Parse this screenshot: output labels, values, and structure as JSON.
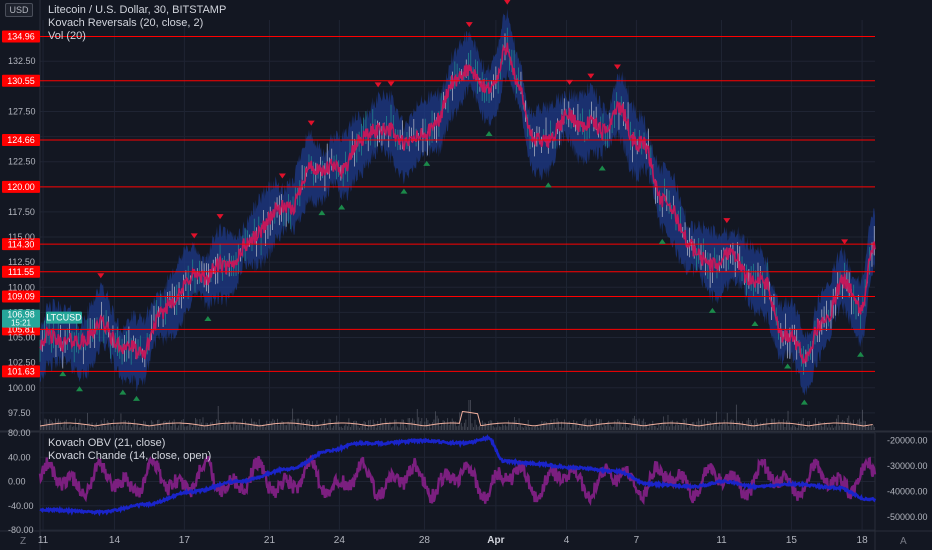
{
  "header": {
    "currency_badge": "USD",
    "title": "Litecoin / U.S. Dollar, 30, BITSTAMP",
    "indicators": [
      "Kovach Reversals (20, close, 2)",
      "Vol (20)"
    ]
  },
  "lower_pane": {
    "indicators": [
      "Kovach OBV (21, close)",
      "Kovach Chande (14, close, open)"
    ]
  },
  "footer": {
    "left_icon_label": "Z",
    "right_icon_label": "A"
  },
  "chart_data": [
    {
      "type": "line",
      "name": "price-pane",
      "y_ticks": [
        97.5,
        100.0,
        102.5,
        105.0,
        107.5,
        110.0,
        112.5,
        115.0,
        117.5,
        120.0,
        122.5,
        125.0,
        127.5,
        130.0,
        132.5
      ],
      "ylim": [
        95.8,
        136.6
      ],
      "x_ticks": [
        "11",
        "14",
        "17",
        "21",
        "24",
        "28",
        "Apr",
        "4",
        "7",
        "11",
        "15",
        "18"
      ],
      "x_tick_index": [
        4,
        98,
        190,
        302,
        394,
        506,
        600,
        693,
        785,
        897,
        989,
        1082
      ],
      "horizontal_levels": [
        134.96,
        130.55,
        124.66,
        120.0,
        114.3,
        111.55,
        109.09,
        105.81,
        101.63
      ],
      "current_price_label": "106.98",
      "current_time_label": "15:21",
      "symbol_label": "LTCUSD",
      "series_colors": {
        "price": "#c2185b",
        "band": "#1e3a8a",
        "level": "#ff0000",
        "buy": "#1b8a4a",
        "sell": "#e0112b",
        "volume": "#787b86"
      },
      "anchors_x": [
        0,
        25,
        50,
        75,
        100,
        130,
        155,
        180,
        210,
        240,
        270,
        300,
        330,
        360,
        390,
        420,
        445,
        470,
        500,
        525,
        545,
        560,
        580,
        600,
        615,
        630,
        650,
        680,
        700,
        720,
        740,
        760,
        790,
        820,
        850,
        880,
        905,
        930,
        955,
        980,
        1005,
        1030,
        1055,
        1080,
        1095
      ],
      "anchors_price": [
        104.5,
        105.0,
        104.2,
        106.3,
        104.8,
        103.2,
        106.5,
        109.5,
        111.2,
        111.8,
        113.8,
        116.8,
        118.2,
        122.0,
        121.5,
        124.2,
        126.2,
        124.8,
        124.6,
        127.0,
        130.2,
        132.0,
        129.8,
        130.7,
        133.5,
        130.2,
        124.2,
        125.5,
        127.2,
        126.0,
        125.8,
        127.5,
        124.5,
        119.0,
        115.0,
        112.0,
        113.5,
        111.5,
        110.0,
        105.0,
        103.5,
        106.0,
        110.5,
        108.0,
        113.5
      ],
      "buy_signal_count": 40,
      "sell_signal_count": 44
    },
    {
      "type": "line",
      "name": "oscillator-pane",
      "left_y_ticks": [
        80.0,
        40.0,
        0.0,
        -40.0,
        -80.0
      ],
      "left_ylim": [
        -80,
        80
      ],
      "right_y_ticks": [
        -20000.0,
        -30000.0,
        -40000.0,
        -50000.0
      ],
      "right_ylim": [
        -55000,
        -17000
      ],
      "series": [
        {
          "name": "Kovach OBV",
          "color": "#1a24c9",
          "anchors_x": [
            0,
            80,
            140,
            200,
            260,
            330,
            380,
            420,
            450,
            500,
            560,
            590,
            610,
            650,
            700,
            760,
            800,
            860,
            900,
            940,
            990,
            1050,
            1090
          ],
          "anchors_y": [
            -47000,
            -48000,
            -45000,
            -40000,
            -36000,
            -31000,
            -24000,
            -21000,
            -21000,
            -20000,
            -21000,
            -19000,
            -28000,
            -29000,
            -30500,
            -32000,
            -37000,
            -38000,
            -36000,
            -38000,
            -37000,
            -38500,
            -43000
          ]
        },
        {
          "name": "Kovach Chande",
          "color": "#7b1f7f",
          "mean": 2,
          "amplitude": 30
        }
      ]
    }
  ]
}
